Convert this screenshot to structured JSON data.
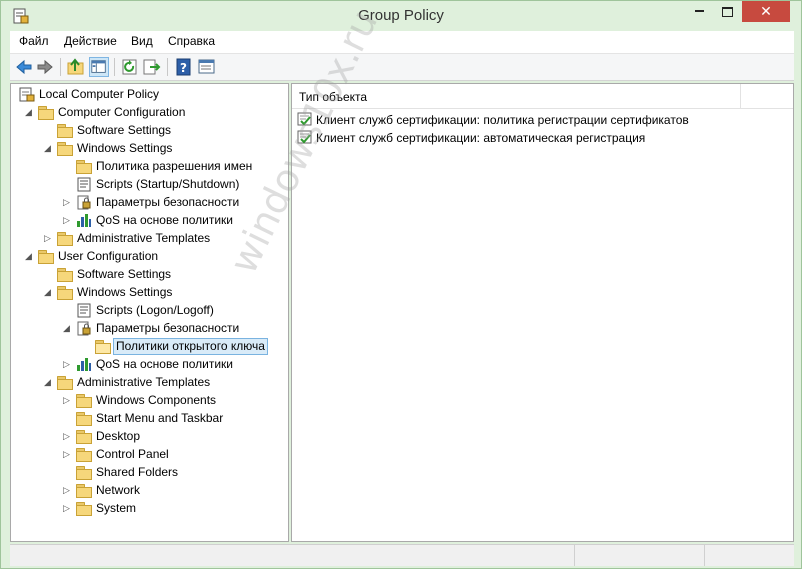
{
  "window": {
    "title": "Group Policy"
  },
  "menu": [
    "Файл",
    "Действие",
    "Вид",
    "Справка"
  ],
  "toolbar": {
    "buttons": [
      "back-icon",
      "forward-icon",
      "up-folder-icon",
      "show-tree-icon",
      "refresh-icon",
      "export-icon",
      "help-icon",
      "properties-icon"
    ]
  },
  "tree": [
    {
      "label": "Local Computer Policy",
      "level": 0,
      "expander": "",
      "icon": "policy-icon"
    },
    {
      "label": "Computer Configuration",
      "level": 1,
      "expander": "open",
      "icon": "folder-icon"
    },
    {
      "label": "Software Settings",
      "level": 2,
      "expander": "",
      "icon": "folder-icon"
    },
    {
      "label": "Windows Settings",
      "level": 2,
      "expander": "open",
      "icon": "folder-icon"
    },
    {
      "label": "Политика разрешения имен",
      "level": 3,
      "expander": "",
      "icon": "folder-icon"
    },
    {
      "label": "Scripts (Startup/Shutdown)",
      "level": 3,
      "expander": "",
      "icon": "script-icon"
    },
    {
      "label": "Параметры безопасности",
      "level": 3,
      "expander": "closed",
      "icon": "security-icon"
    },
    {
      "label": "QoS на основе политики",
      "level": 3,
      "expander": "closed",
      "icon": "chart-icon"
    },
    {
      "label": "Administrative Templates",
      "level": 2,
      "expander": "closed",
      "icon": "folder-icon"
    },
    {
      "label": "User Configuration",
      "level": 1,
      "expander": "open",
      "icon": "folder-icon"
    },
    {
      "label": "Software Settings",
      "level": 2,
      "expander": "",
      "icon": "folder-icon"
    },
    {
      "label": "Windows Settings",
      "level": 2,
      "expander": "open",
      "icon": "folder-icon"
    },
    {
      "label": "Scripts (Logon/Logoff)",
      "level": 3,
      "expander": "",
      "icon": "script-icon"
    },
    {
      "label": "Параметры безопасности",
      "level": 3,
      "expander": "open",
      "icon": "security-icon"
    },
    {
      "label": "Политики открытого ключа",
      "level": 4,
      "expander": "",
      "icon": "folder-open-icon",
      "selected": true
    },
    {
      "label": "QoS на основе политики",
      "level": 3,
      "expander": "closed",
      "icon": "chart-icon"
    },
    {
      "label": "Administrative Templates",
      "level": 2,
      "expander": "open",
      "icon": "folder-icon"
    },
    {
      "label": "Windows Components",
      "level": 3,
      "expander": "closed",
      "icon": "folder-icon"
    },
    {
      "label": "Start Menu and Taskbar",
      "level": 3,
      "expander": "",
      "icon": "folder-icon"
    },
    {
      "label": "Desktop",
      "level": 3,
      "expander": "closed",
      "icon": "folder-icon"
    },
    {
      "label": "Control Panel",
      "level": 3,
      "expander": "closed",
      "icon": "folder-icon"
    },
    {
      "label": "Shared Folders",
      "level": 3,
      "expander": "",
      "icon": "folder-icon"
    },
    {
      "label": "Network",
      "level": 3,
      "expander": "closed",
      "icon": "folder-icon"
    },
    {
      "label": "System",
      "level": 3,
      "expander": "closed",
      "icon": "folder-icon"
    }
  ],
  "list": {
    "column": "Тип объекта",
    "rows": [
      "Клиент служб сертификации: политика регистрации сертификатов",
      "Клиент служб сертификации: автоматическая регистрация"
    ]
  },
  "watermark": "windows10x.ru",
  "colors": {
    "frame": "#dff0dc",
    "close": "#c74a3f",
    "selection": "#d9ebf8"
  }
}
